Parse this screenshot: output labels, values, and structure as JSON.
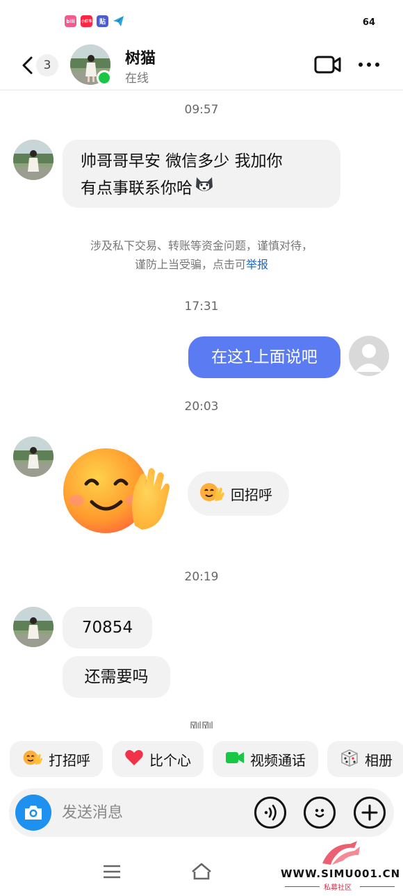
{
  "status_bar": {
    "app_icons": [
      {
        "name": "bilibili-icon",
        "text": "bili",
        "color": "#f45a8d"
      },
      {
        "name": "xiaohongshu-icon",
        "text": "小红书",
        "color": "#ff2442"
      },
      {
        "name": "tieba-icon",
        "text": "贴",
        "color": "#4a5cd6"
      },
      {
        "name": "telegram-icon",
        "text": "",
        "color": "#2aa3df"
      }
    ],
    "right_text": "64"
  },
  "header": {
    "unread_count": "3",
    "contact_name": "树猫",
    "contact_status": "在线"
  },
  "messages": {
    "t1": "09:57",
    "m1_line1": "帅哥哥早安 微信多少 我加你",
    "m1_line2": "有点事联系你哈",
    "notice_line1": "涉及私下交易、转账等资金问题，谨慎对待，",
    "notice_line2_prefix": "谨防上当受骗，点击可",
    "notice_link": "举报",
    "t2": "17:31",
    "m2": "在这1上面说吧",
    "t3": "20:03",
    "greet_button": "回招呼",
    "t4": "20:19",
    "m3": "70854",
    "m4": "还需要吗",
    "partial_time": "刚刚"
  },
  "quick_actions": [
    {
      "label": "打招呼",
      "icon": "wave-emoji-icon"
    },
    {
      "label": "比个心",
      "icon": "heart-icon"
    },
    {
      "label": "视频通话",
      "icon": "video-icon"
    },
    {
      "label": "相册",
      "icon": "dice-icon"
    }
  ],
  "composer": {
    "placeholder": "发送消息"
  },
  "watermark": {
    "site": "WWW.SIMU001.CN",
    "label": "私募社区"
  },
  "colors": {
    "outgoing_bubble": "#5b7bf3",
    "online": "#18c746",
    "camera_button": "#1e90f0",
    "link": "#1a66c9"
  }
}
